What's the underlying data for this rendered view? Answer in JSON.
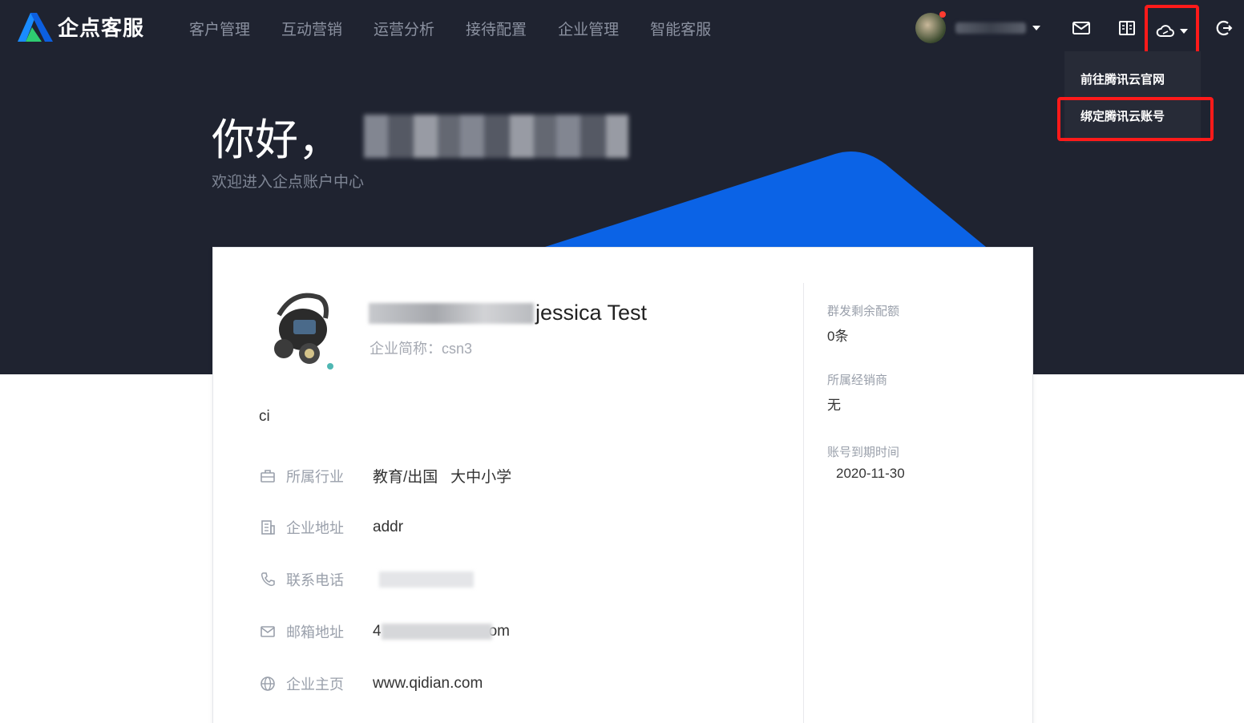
{
  "header": {
    "logo_text": "企点客服",
    "menu": [
      "客户管理",
      "互动营销",
      "运营分析",
      "接待配置",
      "企业管理",
      "智能客服"
    ],
    "icons": [
      "mail-icon",
      "book-icon",
      "cloud-icon",
      "logout-icon"
    ]
  },
  "cloud_dropdown": {
    "items": [
      "前往腾讯云官网",
      "绑定腾讯云账号"
    ]
  },
  "hero": {
    "greeting": "你好，",
    "welcome": "欢迎进入企点账户中心"
  },
  "company": {
    "name_suffix": "jessica Test",
    "short_name": "企业简称：csn3",
    "description": "ci"
  },
  "details": [
    {
      "icon": "briefcase-icon",
      "label": "所属行业",
      "value": "教育/出国   大中小学"
    },
    {
      "icon": "building-icon",
      "label": "企业地址",
      "value": "addr"
    },
    {
      "icon": "phone-icon",
      "label": "联系电话",
      "value": ""
    },
    {
      "icon": "mail-icon",
      "label": "邮箱地址",
      "value_prefix": "4",
      "value_suffix": "om"
    },
    {
      "icon": "globe-icon",
      "label": "企业主页",
      "value": "www.qidian.com"
    }
  ],
  "sidebar": {
    "quota_label": "群发剩余配额",
    "quota_value": "0条",
    "dealer_label": "所属经销商",
    "dealer_value": "无",
    "expiry_label": "账号到期时间",
    "expiry_value": "2020-11-30"
  },
  "colors": {
    "header_bg": "#1f2330",
    "accent_blue": "#0b63e6",
    "highlight_red": "#ff1a1a"
  }
}
